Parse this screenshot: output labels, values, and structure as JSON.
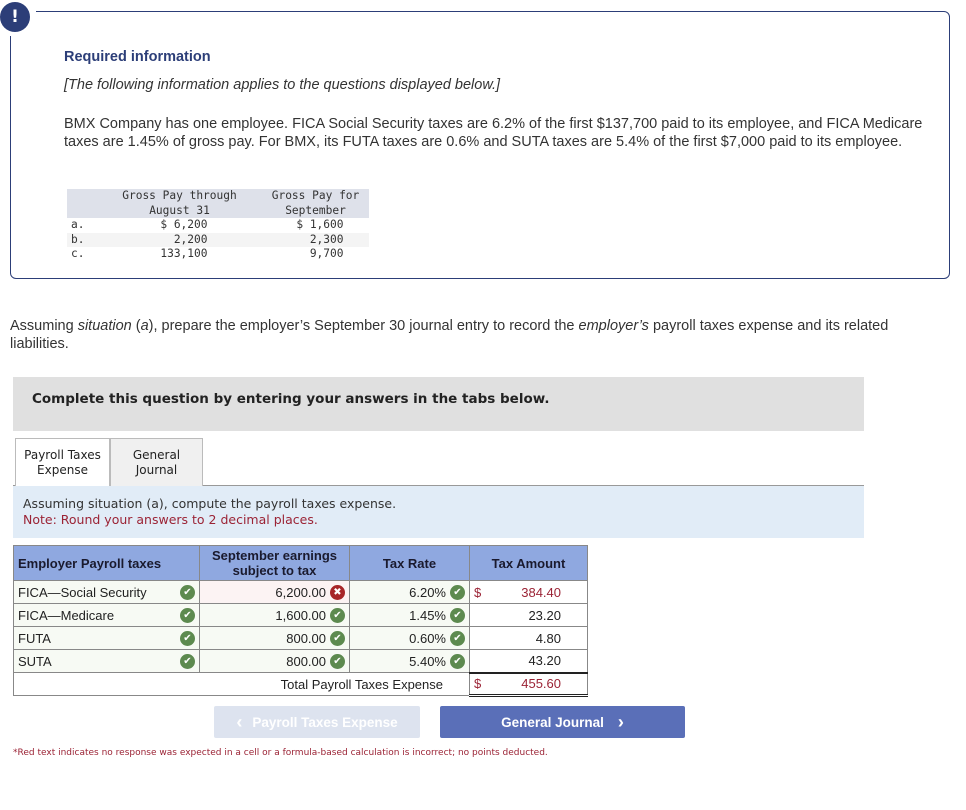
{
  "required_info": {
    "alert_icon": "!",
    "title": "Required information",
    "subtitle": "[The following information applies to the questions displayed below.]",
    "body": "BMX Company has one employee. FICA Social Security taxes are 6.2% of the first $137,700 paid to its employee, and FICA Medicare taxes are 1.45% of gross pay. For BMX, its FUTA taxes are 0.6% and SUTA taxes are 5.4% of the first $7,000 paid to its employee.",
    "given_table": {
      "headers": [
        "",
        "Gross Pay through\nAugust 31",
        "Gross Pay for\nSeptember"
      ],
      "header_line1": [
        "Gross Pay through",
        "Gross Pay for"
      ],
      "header_line2": [
        "August 31",
        "September"
      ],
      "rows": [
        {
          "label": "a.",
          "through_aug": "$ 6,200",
          "september": "$ 1,600"
        },
        {
          "label": "b.",
          "through_aug": "2,200",
          "september": "2,300"
        },
        {
          "label": "c.",
          "through_aug": "133,100",
          "september": "9,700"
        }
      ]
    }
  },
  "question": {
    "part1": "Assuming ",
    "italic1": "situation",
    "part2": " (",
    "italic2": "a",
    "part3": "), prepare the employer’s September 30 journal entry to record the ",
    "italic3": "employer’s",
    "part4": " payroll taxes expense and its related liabilities."
  },
  "instruction_bar": "Complete this question by entering your answers in the tabs below.",
  "tabs": [
    {
      "label": "Payroll Taxes Expense",
      "line1": "Payroll Taxes",
      "line2": "Expense",
      "active": true
    },
    {
      "label": "General Journal",
      "line1": "General",
      "line2": "Journal",
      "active": false
    }
  ],
  "tab_instructions": {
    "text": "Assuming situation (a), compute the payroll taxes expense.",
    "note": "Note: Round your answers to 2 decimal places."
  },
  "tax_table": {
    "headers": {
      "name": "Employer Payroll taxes",
      "earnings_line1": "September earnings",
      "earnings_line2": "subject to tax",
      "rate": "Tax Rate",
      "amount": "Tax Amount"
    },
    "rows": [
      {
        "name": "FICA—Social Security",
        "name_status": "correct",
        "earnings": "6,200.00",
        "earnings_status": "incorrect",
        "rate": "6.20%",
        "rate_status": "correct",
        "currency": "$",
        "amount": "384.40",
        "amount_red": true
      },
      {
        "name": "FICA—Medicare",
        "name_status": "correct",
        "earnings": "1,600.00",
        "earnings_status": "correct",
        "rate": "1.45%",
        "rate_status": "correct",
        "currency": "",
        "amount": "23.20",
        "amount_red": false
      },
      {
        "name": "FUTA",
        "name_status": "correct",
        "earnings": "800.00",
        "earnings_status": "correct",
        "rate": "0.60%",
        "rate_status": "correct",
        "currency": "",
        "amount": "4.80",
        "amount_red": false
      },
      {
        "name": "SUTA",
        "name_status": "correct",
        "earnings": "800.00",
        "earnings_status": "correct",
        "rate": "5.40%",
        "rate_status": "correct",
        "currency": "",
        "amount": "43.20",
        "amount_red": false
      }
    ],
    "total_label": "Total Payroll Taxes Expense",
    "total_currency": "$",
    "total_amount": "455.60"
  },
  "icons": {
    "correct": "✔",
    "incorrect": "✖",
    "prev_chevron": "‹",
    "next_chevron": "›"
  },
  "nav": {
    "prev_label": "Payroll Taxes Expense",
    "next_label": "General Journal"
  },
  "footnote": "*Red text indicates no response was expected in a cell or a formula-based calculation is incorrect; no points deducted.",
  "colors": {
    "brand_navy": "#2c3e78",
    "header_blue": "#8fa8e0",
    "correct_green": "#5d8a4f",
    "incorrect_red": "#a72528",
    "note_red": "#9b2335",
    "next_button": "#5a6fb8",
    "prev_button_disabled": "#dde3ef"
  }
}
